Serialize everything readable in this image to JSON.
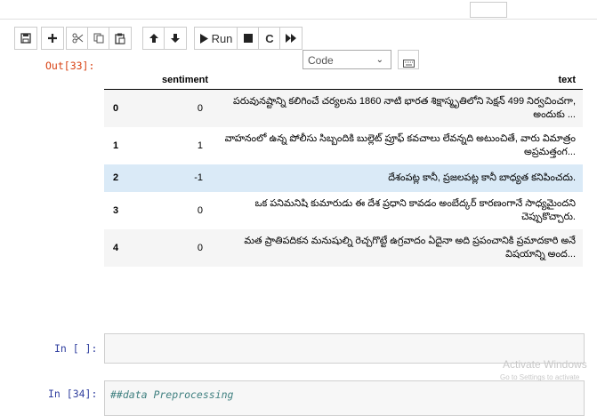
{
  "toolbar": {
    "buttons": [
      {
        "name": "save-button",
        "icon": "save-icon"
      },
      {
        "name": "insert-cell-button",
        "icon": "plus-icon"
      },
      {
        "name": "cut-button",
        "icon": "scissors-icon"
      },
      {
        "name": "copy-button",
        "icon": "copy-icon"
      },
      {
        "name": "paste-button",
        "icon": "paste-icon"
      },
      {
        "name": "move-up-button",
        "icon": "arrow-up-icon"
      },
      {
        "name": "move-down-button",
        "icon": "arrow-down-icon"
      },
      {
        "name": "run-button",
        "icon": "play-icon"
      },
      {
        "name": "interrupt-button",
        "icon": "stop-icon"
      },
      {
        "name": "restart-button",
        "icon": "restart-icon"
      },
      {
        "name": "run-all-button",
        "icon": "fast-forward-icon"
      },
      {
        "name": "command-palette-button",
        "icon": "keyboard-icon"
      }
    ],
    "run_label": "Run",
    "cell_type": "Code"
  },
  "output": {
    "prompt": "Out[33]:",
    "columns": [
      "",
      "sentiment",
      "text"
    ],
    "rows": [
      {
        "index": "0",
        "sentiment": "0",
        "text": "పరువునష్టాన్ని కలిగించే చర్యలను 1860 నాటి భారత శిక్షాస్మృతిలోని సెక్షన్ 499 నిర్వచించగా, అందుకు ..."
      },
      {
        "index": "1",
        "sentiment": "1",
        "text": "వాహనంలో ఉన్న పోలీసు సిబ్బందికి బుల్లెట్ ప్రూఫ్ కవచాలు లేవన్నది అటుంచితే, వారు విమాత్రం అప్రమత్తంగ..."
      },
      {
        "index": "2",
        "sentiment": "-1",
        "text": "దేశంపట్ల కానీ, ప్రజలపట్ల కానీ బాధ్యత కనిపించదు."
      },
      {
        "index": "3",
        "sentiment": "0",
        "text": "ఒక పనిమనిషి కుమారుడు ఈ దేశ ప్రధాని కావడం అంబేద్కర్ కారణంగానే సాధ్యమైందని చెప్పుకొచ్చారు."
      },
      {
        "index": "4",
        "sentiment": "0",
        "text": "మత ప్రాతిపదికన మనుషుల్ని రెచ్చగొట్టే ఉగ్రవాదం ఏదైనా అది ప్రపంచానికి ప్రమాదకారి అనే విషయాన్ని అంద..."
      }
    ]
  },
  "cells": [
    {
      "prompt": "In [ ]:",
      "code": ""
    },
    {
      "prompt": "In [34]:",
      "code": "##data Preprocessing"
    }
  ],
  "watermark": {
    "title": "Activate Windows",
    "subtitle": "Go to Settings to activate"
  }
}
